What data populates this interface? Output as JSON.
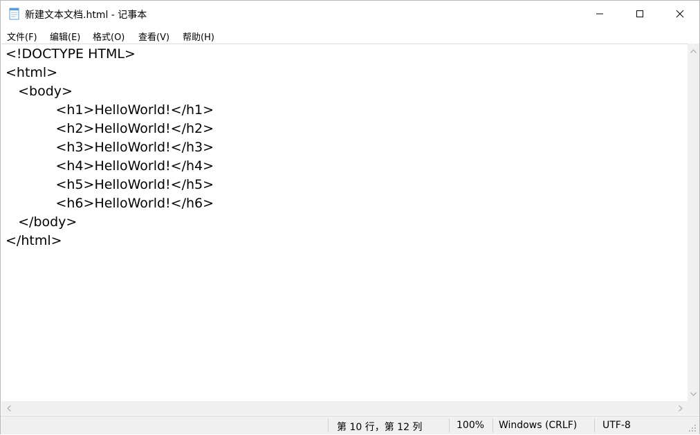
{
  "window": {
    "title": "新建文本文档.html - 记事本"
  },
  "icons": {
    "app": "notepad-icon",
    "minimize": "minimize-icon",
    "maximize": "maximize-icon",
    "close": "close-icon"
  },
  "menu": {
    "file": "文件(F)",
    "edit": "编辑(E)",
    "format": "格式(O)",
    "view": "查看(V)",
    "help": "帮助(H)"
  },
  "editor": {
    "lines": [
      "<!DOCTYPE HTML>",
      "<html>",
      "   <body>",
      "            <h1>HelloWorld!</h1>",
      "            <h2>HelloWorld!</h2>",
      "            <h3>HelloWorld!</h3>",
      "            <h4>HelloWorld!</h4>",
      "            <h5>HelloWorld!</h5>",
      "            <h6>HelloWorld!</h6>",
      "   </body>",
      "</html>"
    ]
  },
  "status": {
    "position": "第 10 行，第 12 列",
    "zoom": "100%",
    "line_ending": "Windows (CRLF)",
    "encoding": "UTF-8"
  },
  "colors": {
    "chrome": "#f0f0f0",
    "text": "#000000",
    "icon_blue": "#5b9bd5"
  }
}
